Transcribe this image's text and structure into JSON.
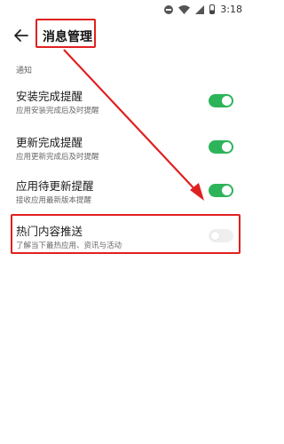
{
  "status_bar": {
    "time": "3:18",
    "icons": [
      "do-not-disturb-icon",
      "wifi-icon",
      "signal-icon",
      "battery-icon"
    ]
  },
  "header": {
    "title": "消息管理",
    "back_icon": "arrow-left-icon"
  },
  "section": {
    "label": "通知"
  },
  "settings": [
    {
      "title": "安装完成提醒",
      "desc": "应用安装完成后及时提醒",
      "enabled": true
    },
    {
      "title": "更新完成提醒",
      "desc": "应用更新完成后及时提醒",
      "enabled": true
    },
    {
      "title": "应用待更新提醒",
      "desc": "接收应用最新版本提醒",
      "enabled": true
    },
    {
      "title": "热门内容推送",
      "desc": "了解当下最热应用、资讯与活动",
      "enabled": false
    }
  ],
  "colors": {
    "toggle_on": "#2db45a",
    "toggle_off": "#efefef",
    "annotation": "#e02020"
  }
}
